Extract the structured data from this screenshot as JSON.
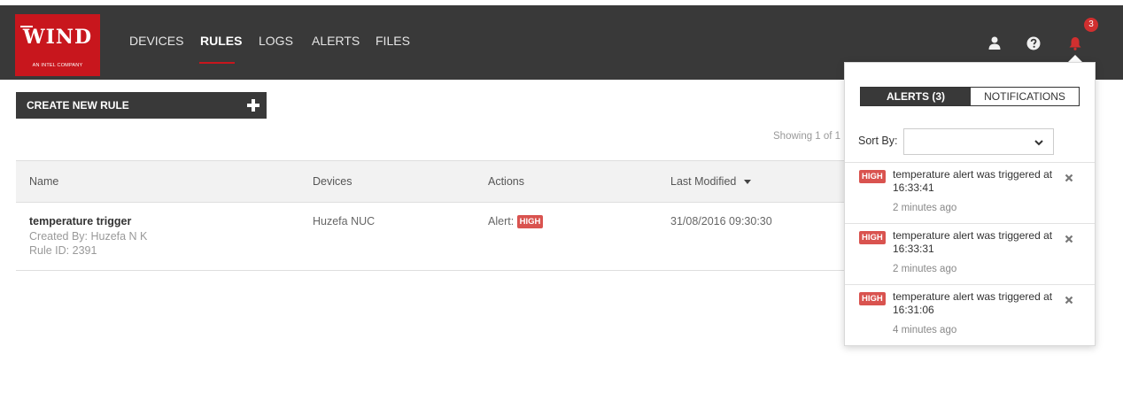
{
  "logo": {
    "brand": "WIND",
    "subtitle": "AN INTEL COMPANY",
    "color": "#c8161d"
  },
  "nav": {
    "items": [
      {
        "label": "DEVICES"
      },
      {
        "label": "RULES",
        "active": true
      },
      {
        "label": "LOGS"
      },
      {
        "label": "ALERTS"
      },
      {
        "label": "FILES"
      }
    ]
  },
  "header_icons": {
    "user": "user-icon",
    "help": "help-icon",
    "bell": "bell-icon",
    "bell_badge": "3"
  },
  "toolbar": {
    "create_label": "CREATE NEW RULE",
    "plus_icon": "plus-icon"
  },
  "pagination": {
    "showing_text": "Showing 1 of 1"
  },
  "table": {
    "headers": {
      "name": "Name",
      "devices": "Devices",
      "actions": "Actions",
      "last_modified": "Last Modified"
    },
    "rows": [
      {
        "name": "temperature trigger",
        "created_by": "Created By: Huzefa N K",
        "rule_id": "Rule ID: 2391",
        "devices": "Huzefa NUC",
        "action_label": "Alert:",
        "action_level": "HIGH",
        "last_modified": "31/08/2016 09:30:30"
      }
    ]
  },
  "notifications": {
    "tabs": {
      "alerts": "ALERTS (3)",
      "notifications": "NOTIFICATIONS"
    },
    "sort_label": "Sort By:",
    "sort_value": "",
    "alerts": [
      {
        "level": "HIGH",
        "text": "temperature alert was triggered at 16:33:41",
        "time": "2 minutes ago"
      },
      {
        "level": "HIGH",
        "text": "temperature alert was triggered at 16:33:31",
        "time": "2 minutes ago"
      },
      {
        "level": "HIGH",
        "text": "temperature alert was triggered at 16:31:06",
        "time": "4 minutes ago"
      }
    ]
  },
  "colors": {
    "header_bg": "#393939",
    "accent_red": "#c8161d",
    "badge_red": "#d9534f"
  }
}
